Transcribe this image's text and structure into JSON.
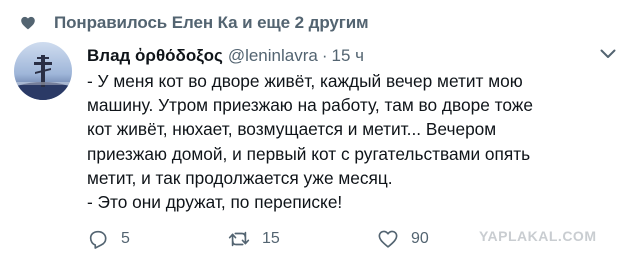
{
  "social_context": {
    "text": "Понравилось Елен Ка и еще 2 другим",
    "icon": "heart-icon"
  },
  "tweet": {
    "author_name": "Влад ὀρθόδοξος",
    "handle": "@leninlavra",
    "separator": "·",
    "time": "15 ч",
    "text_lines": [
      "- У меня кот во дворе живёт, каждый вечер метит мою",
      "машину. Утром приезжаю на работу, там во дворе тоже",
      "кот живёт, нюхает, возмущается и метит... Вечером",
      "приезжаю домой, и первый кот с ругательствами опять",
      "метит, и так продолжается уже месяц.",
      "- Это они дружат, по переписке!"
    ]
  },
  "actions": {
    "reply_count": "5",
    "retweet_count": "15",
    "like_count": "90"
  },
  "watermark": "YAPLAKAL.COM",
  "colors": {
    "text": "#0f1419",
    "secondary": "#536471",
    "watermark": "#c9cdd1"
  }
}
